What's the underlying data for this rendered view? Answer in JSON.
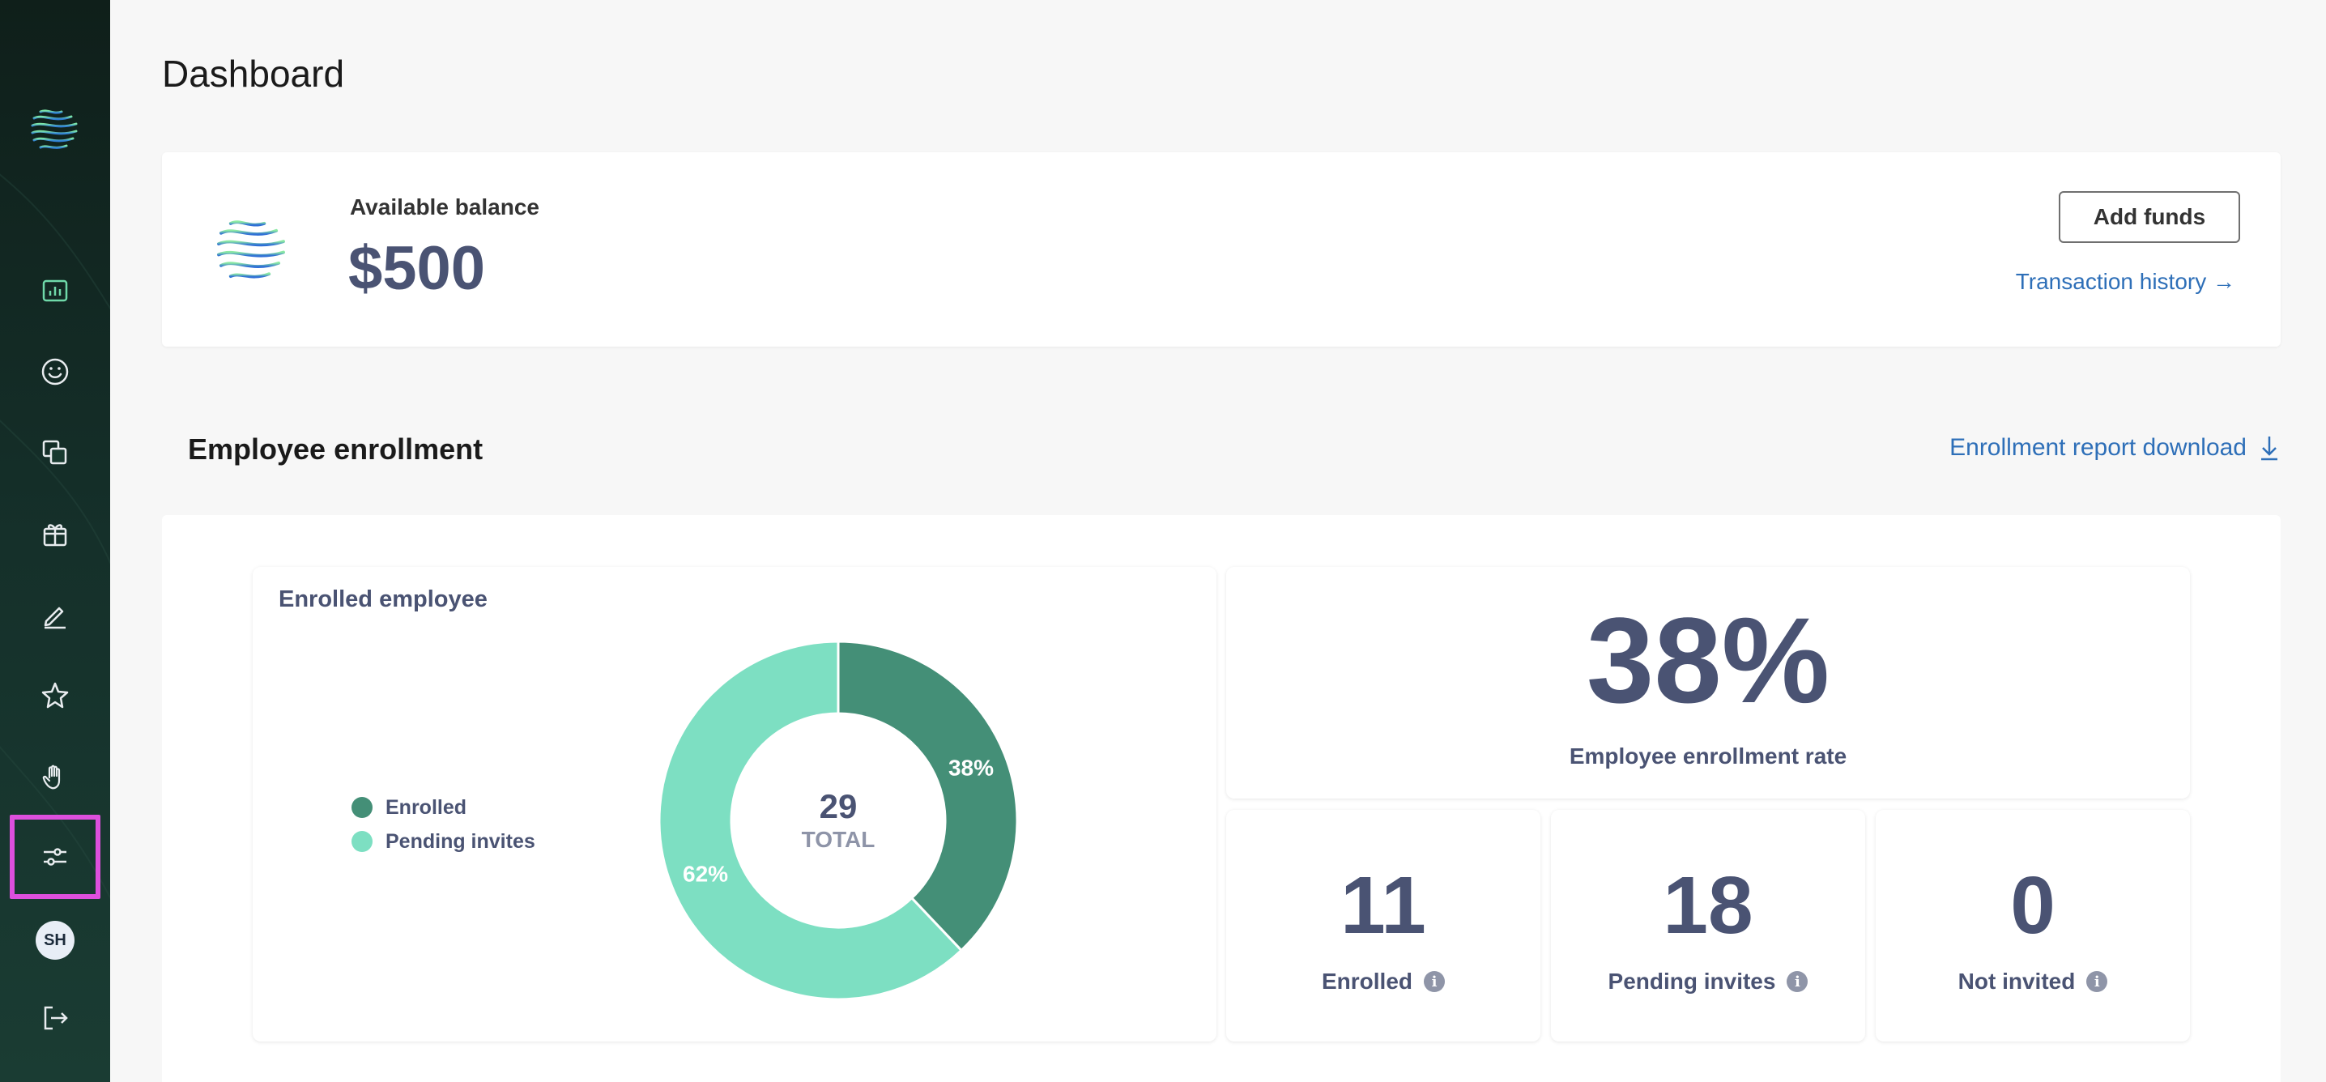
{
  "sidebar": {
    "logo_icon": "wave-logo-icon",
    "items": [
      {
        "name": "dashboard",
        "icon": "chart-bar-icon",
        "active": true
      },
      {
        "name": "employees",
        "icon": "smiley-icon"
      },
      {
        "name": "documents",
        "icon": "copy-icon"
      },
      {
        "name": "benefits",
        "icon": "gift-icon"
      },
      {
        "name": "edit",
        "icon": "pencil-icon"
      },
      {
        "name": "favorites",
        "icon": "star-icon"
      },
      {
        "name": "requests",
        "icon": "hand-icon"
      },
      {
        "name": "settings",
        "icon": "sliders-icon",
        "highlighted": true
      }
    ],
    "avatar_initials": "SH",
    "logout_icon": "logout-icon"
  },
  "page": {
    "title": "Dashboard"
  },
  "balance": {
    "label": "Available balance",
    "amount": "$500",
    "add_funds_label": "Add funds",
    "transaction_history_label": "Transaction history →"
  },
  "enrollment": {
    "section_title": "Employee enrollment",
    "report_link_label": "Enrollment report download",
    "chart_card_title": "Enrolled employee",
    "rate_value": "38%",
    "rate_label": "Employee enrollment rate",
    "stats": [
      {
        "value": "11",
        "label": "Enrolled"
      },
      {
        "value": "18",
        "label": "Pending invites"
      },
      {
        "value": "0",
        "label": "Not invited"
      }
    ]
  },
  "chart_data": {
    "type": "pie",
    "categories": [
      "Enrolled",
      "Pending invites"
    ],
    "values": [
      11,
      18
    ],
    "slice_labels": [
      "38%",
      "62%"
    ],
    "center_value": "29",
    "center_label": "TOTAL",
    "colors": [
      "#448f77",
      "#7ddfc2"
    ],
    "legend": [
      "Enrolled",
      "Pending invites"
    ],
    "legend_position": "left"
  },
  "colors": {
    "accent_text": "#4a5373",
    "link": "#2e6fb8",
    "highlight_border": "#dd4fdd"
  }
}
